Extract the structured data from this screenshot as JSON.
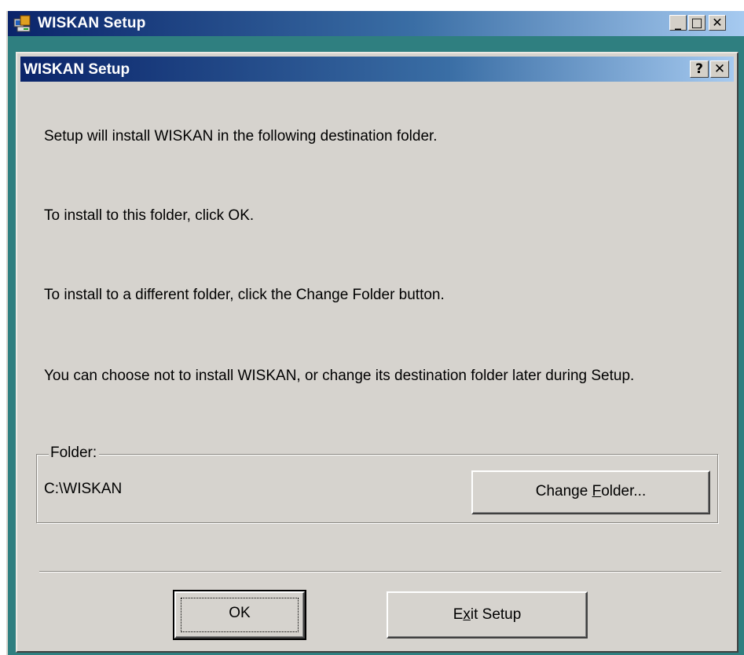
{
  "outer_window": {
    "title": "WISKAN Setup",
    "minimize_label": "_",
    "maximize_label": "□",
    "close_label": "✕"
  },
  "dialog": {
    "title": "WISKAN Setup",
    "help_label": "?",
    "close_label": "✕",
    "messages": [
      "Setup will install WISKAN in the following destination folder.",
      "To install to this folder, click OK.",
      "To install to a different folder, click the Change Folder button.",
      "You can choose not to install WISKAN, or change its destination folder later during Setup."
    ],
    "folder_group": {
      "legend": "Folder:",
      "path": "C:\\WISKAN",
      "change_button": {
        "before": "Change ",
        "mnemonic": "F",
        "after": "older..."
      }
    },
    "buttons": {
      "ok": "OK",
      "exit": {
        "before": "E",
        "mnemonic": "x",
        "after": "it Setup"
      }
    }
  },
  "colors": {
    "title_bar_start": "#0a246a",
    "title_bar_end": "#a6caf0",
    "dialog_face": "#d6d3ce",
    "desktop": "#2f7f80"
  }
}
